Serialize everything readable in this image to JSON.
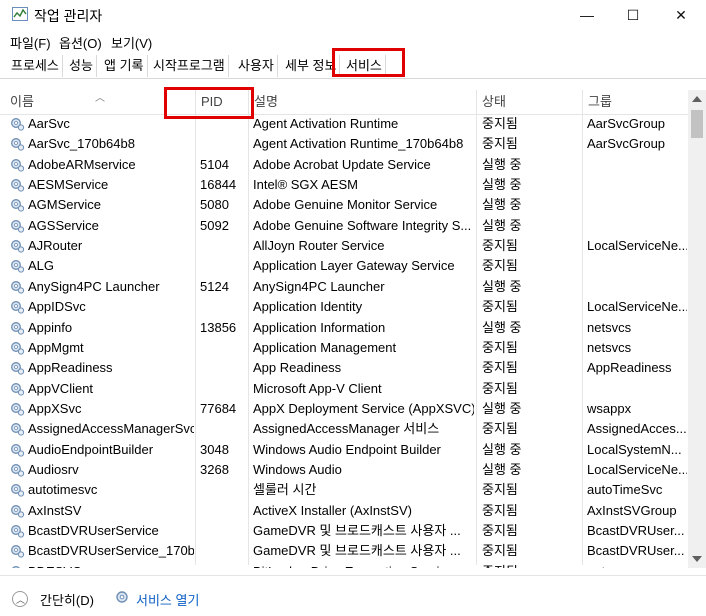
{
  "window": {
    "title": "작업 관리자",
    "minimize_glyph": "—",
    "maximize_glyph": "☐",
    "close_glyph": "✕"
  },
  "menu": [
    "파일(F)",
    "옵션(O)",
    "보기(V)"
  ],
  "tabs": [
    "프로세스",
    "성능",
    "앱 기록",
    "시작프로그램",
    "사용자",
    "세부 정보",
    "서비스"
  ],
  "active_tab": "서비스",
  "columns": [
    "이름",
    "PID",
    "설명",
    "상태",
    "그룹"
  ],
  "rows": [
    {
      "name": "AarSvc",
      "pid": "",
      "desc": "Agent Activation Runtime",
      "status": "중지됨",
      "group": "AarSvcGroup"
    },
    {
      "name": "AarSvc_170b64b8",
      "pid": "",
      "desc": "Agent Activation Runtime_170b64b8",
      "status": "중지됨",
      "group": "AarSvcGroup"
    },
    {
      "name": "AdobeARMservice",
      "pid": "5104",
      "desc": "Adobe Acrobat Update Service",
      "status": "실행 중",
      "group": ""
    },
    {
      "name": "AESMService",
      "pid": "16844",
      "desc": "Intel® SGX AESM",
      "status": "실행 중",
      "group": ""
    },
    {
      "name": "AGMService",
      "pid": "5080",
      "desc": "Adobe Genuine Monitor Service",
      "status": "실행 중",
      "group": ""
    },
    {
      "name": "AGSService",
      "pid": "5092",
      "desc": "Adobe Genuine Software Integrity S...",
      "status": "실행 중",
      "group": ""
    },
    {
      "name": "AJRouter",
      "pid": "",
      "desc": "AllJoyn Router Service",
      "status": "중지됨",
      "group": "LocalServiceNe..."
    },
    {
      "name": "ALG",
      "pid": "",
      "desc": "Application Layer Gateway Service",
      "status": "중지됨",
      "group": ""
    },
    {
      "name": "AnySign4PC Launcher",
      "pid": "5124",
      "desc": "AnySign4PC Launcher",
      "status": "실행 중",
      "group": ""
    },
    {
      "name": "AppIDSvc",
      "pid": "",
      "desc": "Application Identity",
      "status": "중지됨",
      "group": "LocalServiceNe..."
    },
    {
      "name": "Appinfo",
      "pid": "13856",
      "desc": "Application Information",
      "status": "실행 중",
      "group": "netsvcs"
    },
    {
      "name": "AppMgmt",
      "pid": "",
      "desc": "Application Management",
      "status": "중지됨",
      "group": "netsvcs"
    },
    {
      "name": "AppReadiness",
      "pid": "",
      "desc": "App Readiness",
      "status": "중지됨",
      "group": "AppReadiness"
    },
    {
      "name": "AppVClient",
      "pid": "",
      "desc": "Microsoft App-V Client",
      "status": "중지됨",
      "group": ""
    },
    {
      "name": "AppXSvc",
      "pid": "77684",
      "desc": "AppX Deployment Service (AppXSVC)",
      "status": "실행 중",
      "group": "wsappx"
    },
    {
      "name": "AssignedAccessManagerSvc",
      "pid": "",
      "desc": "AssignedAccessManager 서비스",
      "status": "중지됨",
      "group": "AssignedAcces..."
    },
    {
      "name": "AudioEndpointBuilder",
      "pid": "3048",
      "desc": "Windows Audio Endpoint Builder",
      "status": "실행 중",
      "group": "LocalSystemN..."
    },
    {
      "name": "Audiosrv",
      "pid": "3268",
      "desc": "Windows Audio",
      "status": "실행 중",
      "group": "LocalServiceNe..."
    },
    {
      "name": "autotimesvc",
      "pid": "",
      "desc": "셀룰러 시간",
      "status": "중지됨",
      "group": "autoTimeSvc"
    },
    {
      "name": "AxInstSV",
      "pid": "",
      "desc": "ActiveX Installer (AxInstSV)",
      "status": "중지됨",
      "group": "AxInstSVGroup"
    },
    {
      "name": "BcastDVRUserService",
      "pid": "",
      "desc": "GameDVR 및 브로드캐스트 사용자 ...",
      "status": "중지됨",
      "group": "BcastDVRUser..."
    },
    {
      "name": "BcastDVRUserService_170b...",
      "pid": "",
      "desc": "GameDVR 및 브로드캐스트 사용자 ...",
      "status": "중지됨",
      "group": "BcastDVRUser..."
    },
    {
      "name": "BDESVC",
      "pid": "",
      "desc": "BitLocker Drive Encryption Service",
      "status": "중지됨",
      "group": "netsvcs"
    }
  ],
  "footer": {
    "fewer_details": "간단히(D)",
    "open_services": "서비스 열기"
  },
  "highlight_color": "#e00000"
}
